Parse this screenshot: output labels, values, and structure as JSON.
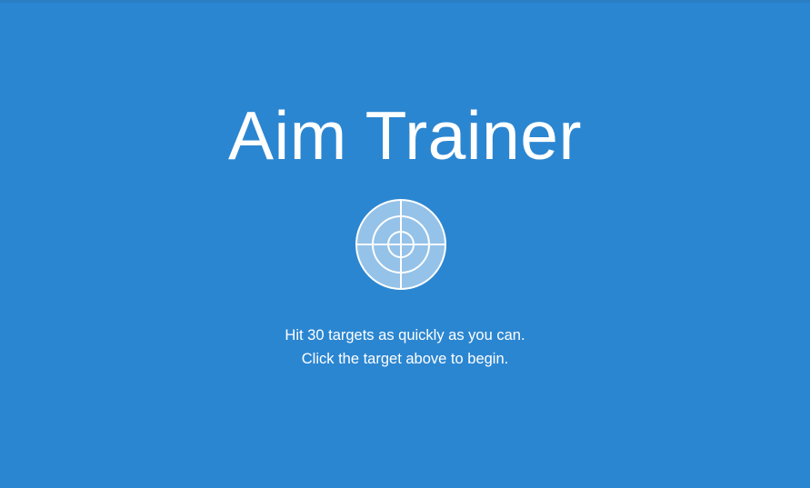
{
  "app": {
    "title": "Aim Trainer",
    "start_target_icon": "crosshair-target-icon",
    "instructions": {
      "line1": "Hit 30 targets as quickly as you can.",
      "line2": "Click the target above to begin."
    }
  },
  "colors": {
    "background": "#2b86d1",
    "target_fill": "#95c2e8",
    "target_stroke": "#ffffff",
    "text": "#ffffff"
  }
}
